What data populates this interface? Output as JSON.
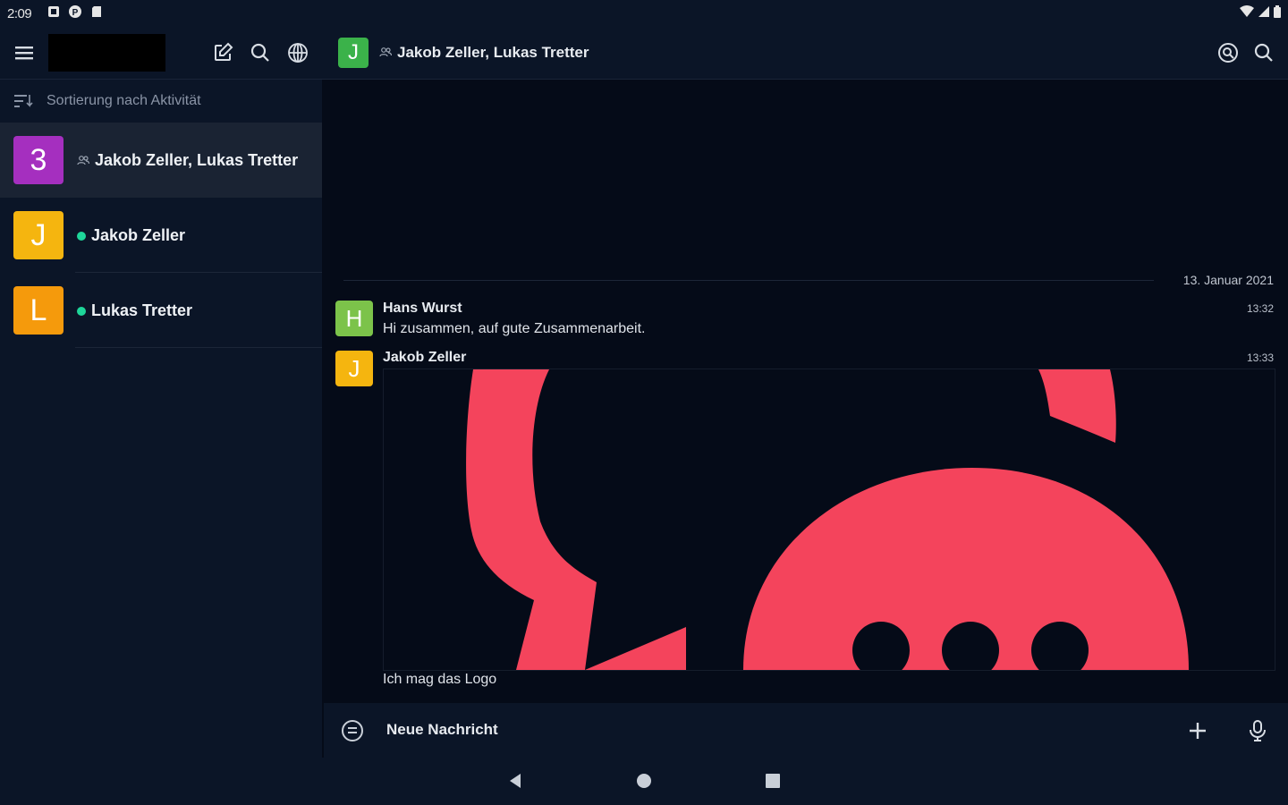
{
  "status_bar": {
    "time": "2:09",
    "icons": [
      "notification-icon",
      "app-icon",
      "sd-card-icon"
    ],
    "right_icons": [
      "wifi-icon",
      "signal-icon",
      "battery-icon"
    ]
  },
  "sidebar": {
    "sort_label": "Sortierung nach Aktivität",
    "rooms": [
      {
        "avatar_letter": "3",
        "avatar_color": "#a52fbf",
        "name": "Jakob Zeller, Lukas Tretter",
        "type": "group"
      },
      {
        "avatar_letter": "J",
        "avatar_color": "#f5b50f",
        "name": "Jakob Zeller",
        "type": "direct"
      },
      {
        "avatar_letter": "L",
        "avatar_color": "#f59a0c",
        "name": "Lukas Tretter",
        "type": "direct"
      }
    ]
  },
  "conversation": {
    "avatar_letter": "J",
    "avatar_color": "#3bb24a",
    "title": "Jakob Zeller, Lukas Tretter"
  },
  "messages": {
    "date_separator": "13. Januar 2021",
    "items": [
      {
        "avatar_letter": "H",
        "avatar_color": "#7cc34a",
        "sender": "Hans Wurst",
        "time": "13:32",
        "text": "Hi zusammen, auf gute Zusammenarbeit."
      },
      {
        "avatar_letter": "J",
        "avatar_color": "#f5b50f",
        "sender": "Jakob Zeller",
        "time": "13:33",
        "text": "Ich mag das Logo"
      }
    ]
  },
  "composer": {
    "placeholder": "Neue Nachricht"
  },
  "colors": {
    "logo_accent": "#f4445c",
    "background": "#050b18",
    "panel": "#0b1527",
    "online": "#1ed69a"
  }
}
